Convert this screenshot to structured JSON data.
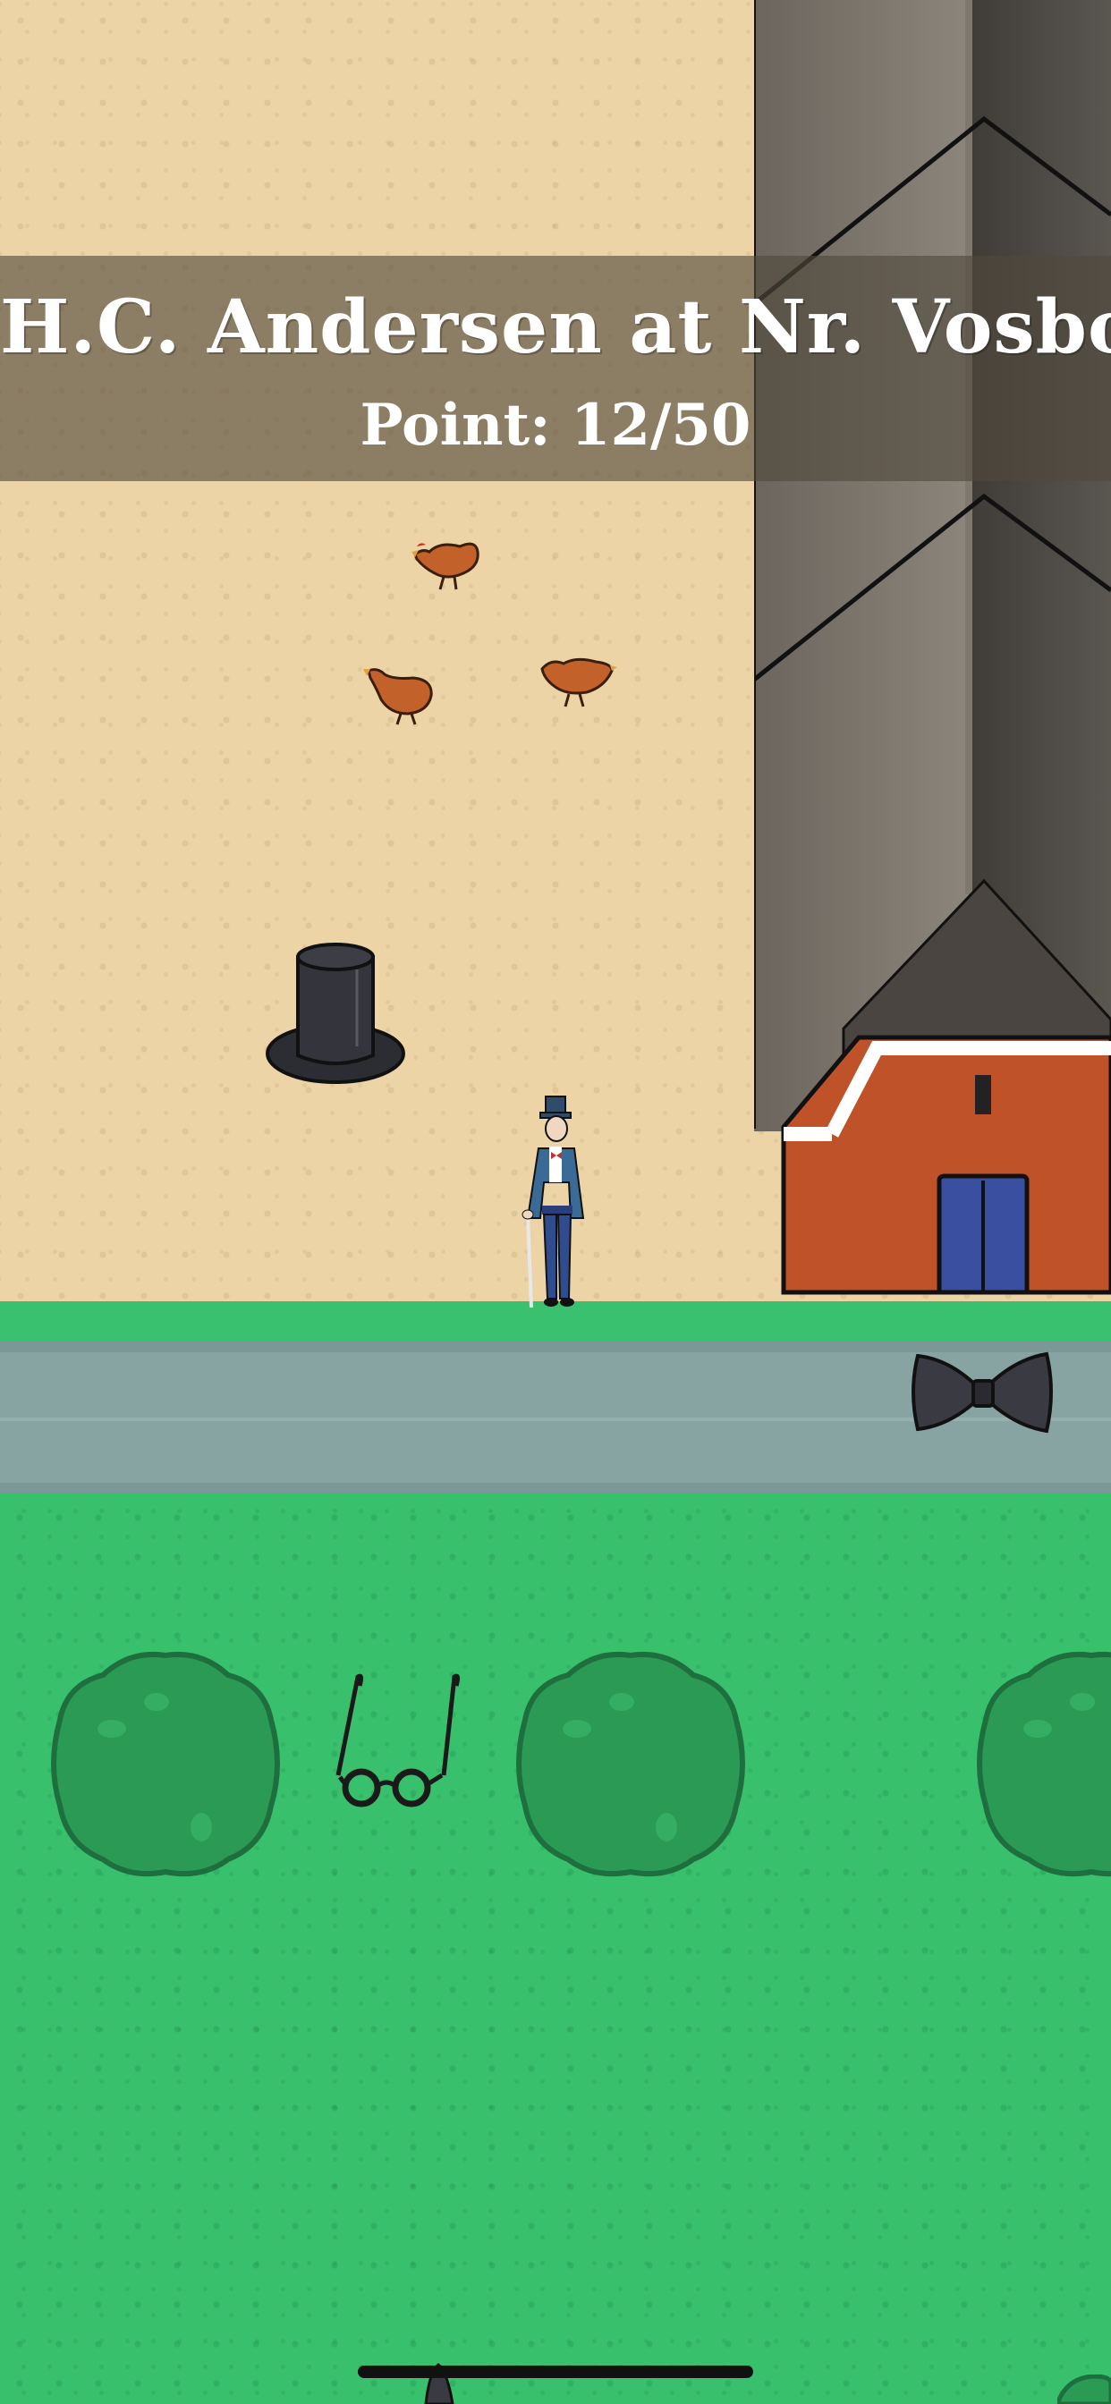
{
  "game": {
    "title": "H.C. Andersen at Nr. Vosborg",
    "score_text": "Point: 12/50",
    "score": {
      "current": 12,
      "total": 50
    }
  },
  "scene": {
    "items": [
      "chicken",
      "chicken",
      "chicken",
      "top-hat",
      "bow-tie",
      "glasses"
    ],
    "character": "hans-christian-andersen",
    "colors": {
      "sand": "#ecd4a6",
      "grass": "#38c06d",
      "road": "#87a3a2",
      "barn_wall": "#c0522a",
      "door": "#3a4fa0"
    }
  }
}
